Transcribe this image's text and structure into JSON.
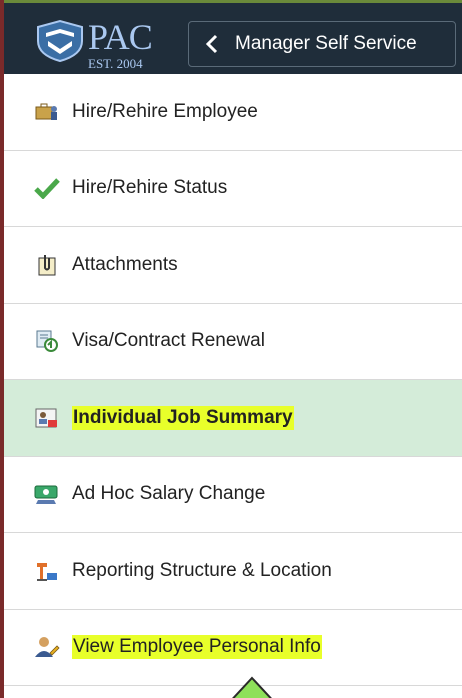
{
  "header": {
    "logo_text": "PAC",
    "logo_est": "EST. 2004",
    "back_label": "Manager Self Service"
  },
  "menu": {
    "items": [
      {
        "label": "Hire/Rehire Employee",
        "icon": "briefcase-person-icon"
      },
      {
        "label": "Hire/Rehire Status",
        "icon": "checkmark-icon"
      },
      {
        "label": "Attachments",
        "icon": "paperclip-icon"
      },
      {
        "label": "Visa/Contract Renewal",
        "icon": "document-renew-icon"
      },
      {
        "label": "Individual Job Summary",
        "icon": "job-summary-icon",
        "selected": true,
        "highlighted": true
      },
      {
        "label": "Ad Hoc Salary Change",
        "icon": "salary-icon"
      },
      {
        "label": "Reporting Structure & Location",
        "icon": "org-structure-icon"
      },
      {
        "label": "View Employee Personal Info",
        "icon": "person-pencil-icon",
        "highlighted": true
      }
    ]
  },
  "colors": {
    "header_bg": "#1f2d3a",
    "selected_bg": "#d4ecd9",
    "highlight": "#e8ff2a",
    "arrow": "#8ee05a"
  }
}
